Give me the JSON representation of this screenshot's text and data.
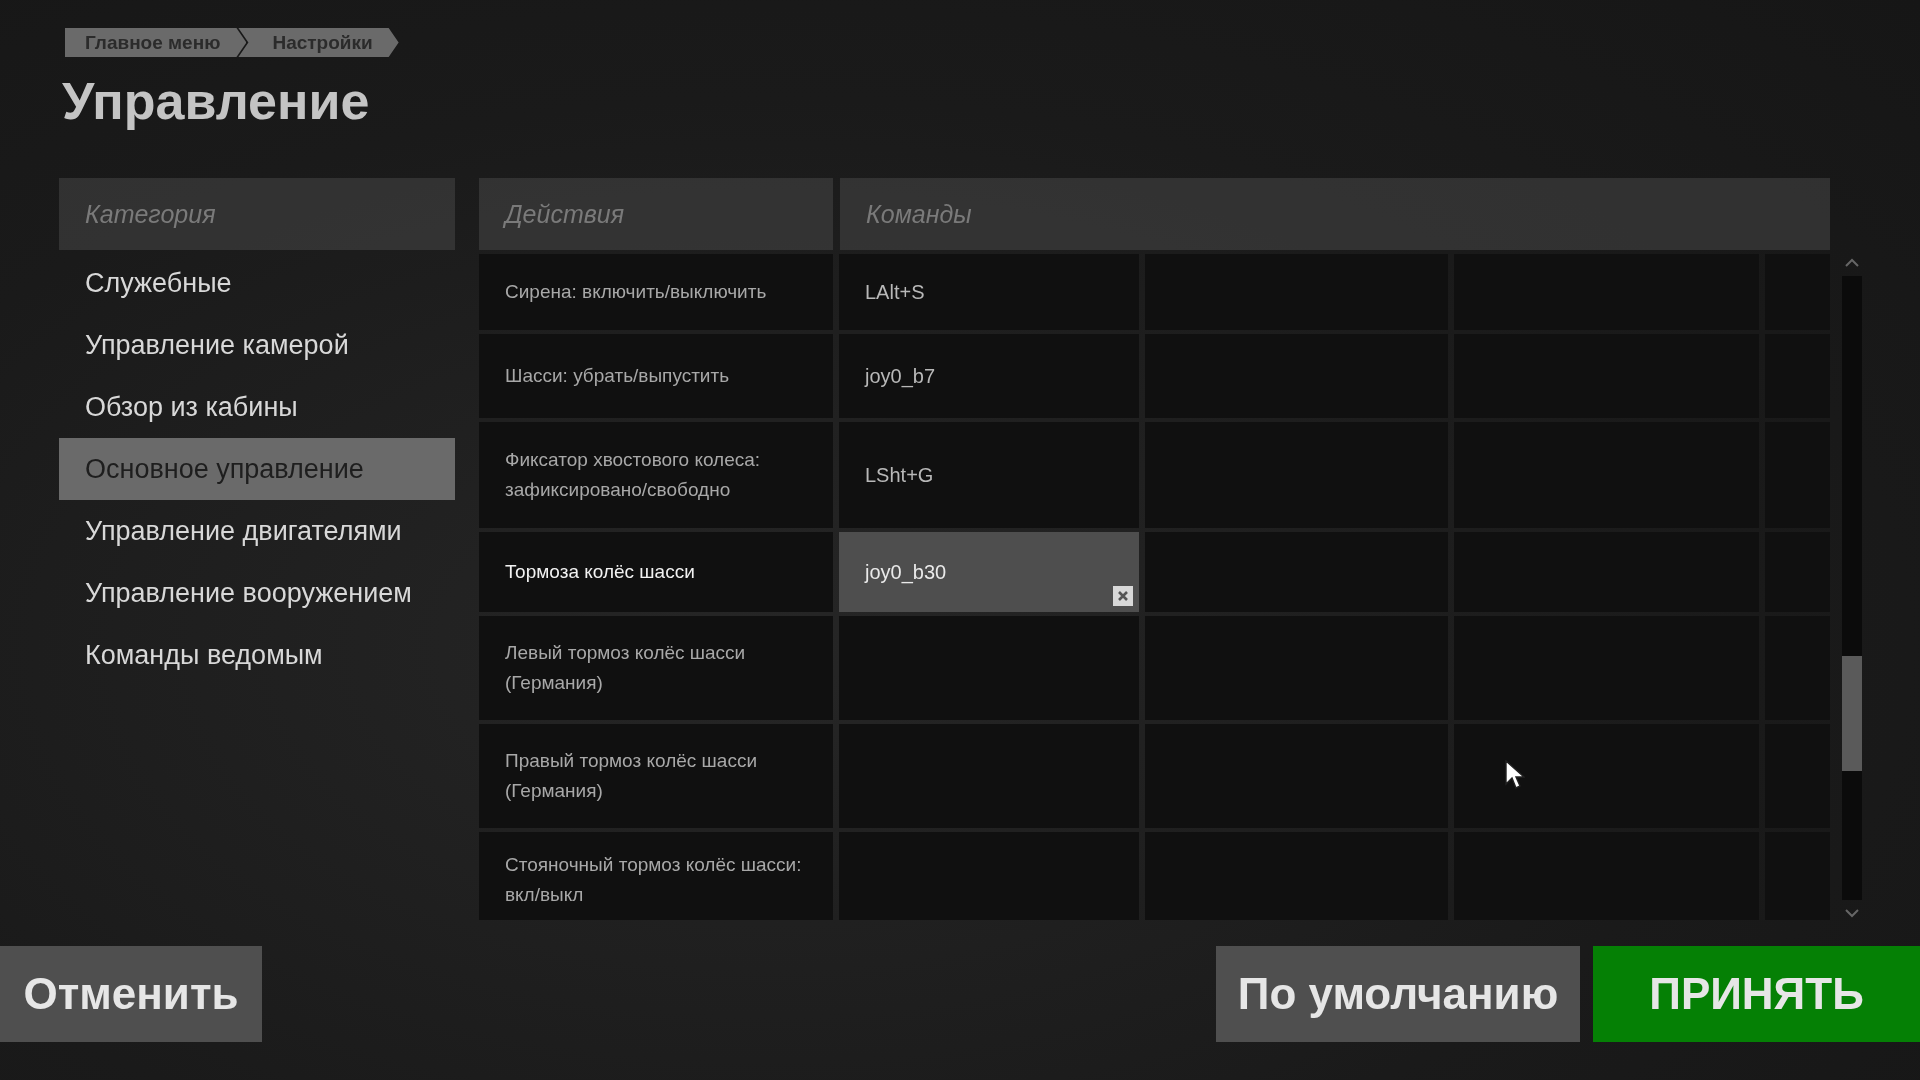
{
  "breadcrumb": [
    {
      "label": "Главное меню"
    },
    {
      "label": "Настройки"
    }
  ],
  "title": "Управление",
  "categories": {
    "header": "Категория",
    "items": [
      {
        "label": "Служебные",
        "selected": false
      },
      {
        "label": "Управление камерой",
        "selected": false
      },
      {
        "label": "Обзор из кабины",
        "selected": false
      },
      {
        "label": "Основное управление",
        "selected": true
      },
      {
        "label": "Управление двигателями",
        "selected": false
      },
      {
        "label": "Управление вооружением",
        "selected": false
      },
      {
        "label": "Команды ведомым",
        "selected": false
      }
    ]
  },
  "table": {
    "columns": [
      "Действия",
      "Команды"
    ],
    "rows": [
      {
        "action": "Сирена: включить/выключить",
        "selected": false,
        "bindings": [
          {
            "key": "LAlt+S",
            "selected": false
          }
        ]
      },
      {
        "action": "Шасси: убрать/выпустить",
        "selected": false,
        "bindings": [
          {
            "key": "joy0_b7",
            "selected": false
          }
        ]
      },
      {
        "action": "Фиксатор хвостового колеса: зафиксировано/свободно",
        "selected": false,
        "bindings": [
          {
            "key": "LSht+G",
            "selected": false
          }
        ]
      },
      {
        "action": "Тормоза колёс шасси",
        "selected": true,
        "bindings": [
          {
            "key": "joy0_b30",
            "selected": true
          }
        ]
      },
      {
        "action": "Левый тормоз колёс шасси (Германия)",
        "selected": false,
        "bindings": []
      },
      {
        "action": "Правый тормоз колёс шасси (Германия)",
        "selected": false,
        "bindings": []
      },
      {
        "action": "Стояночный тормоз колёс шасси: вкл/выкл",
        "selected": false,
        "bindings": []
      }
    ]
  },
  "buttons": {
    "cancel": "Отменить",
    "defaults": "По умолчанию",
    "accept": "ПРИНЯТЬ"
  }
}
